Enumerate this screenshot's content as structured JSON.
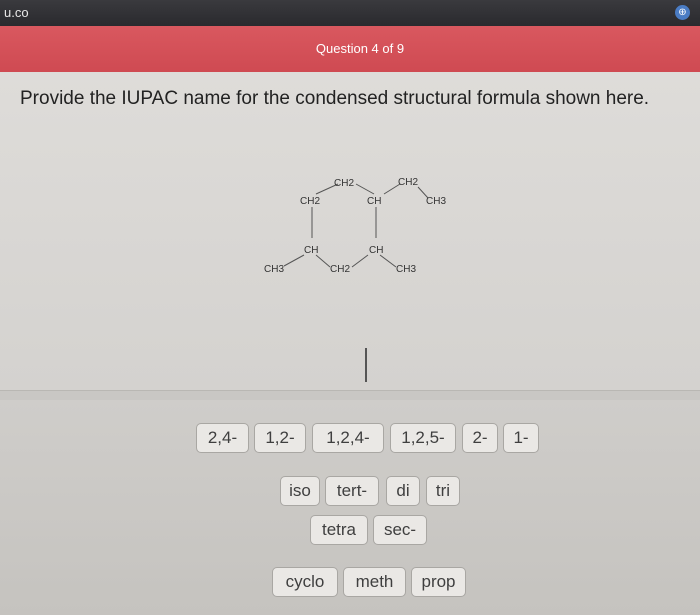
{
  "browser": {
    "url_fragment": "u.co"
  },
  "header": {
    "question_counter": "Question 4 of 9"
  },
  "question": {
    "prompt": "Provide the IUPAC name for the condensed structural formula shown here.",
    "formula_labels": {
      "top_ch2_left": "CH2",
      "top_ch2_right": "CH2",
      "ring_ch2_left": "CH2",
      "ring_ch": "CH",
      "right_ch3": "CH3",
      "ring_ch_bottom_left": "CH",
      "ring_ch_bottom_right": "CH",
      "left_ch3": "CH3",
      "bottom_ch2": "CH2",
      "bottom_ch3": "CH3"
    }
  },
  "tiles": {
    "t_2_4": "2,4-",
    "t_1_2": "1,2-",
    "t_1_2_4": "1,2,4-",
    "t_1_2_5": "1,2,5-",
    "t_2": "2-",
    "t_1": "1-",
    "iso": "iso",
    "tert": "tert-",
    "di": "di",
    "tri": "tri",
    "tetra": "tetra",
    "sec": "sec-",
    "cyclo": "cyclo",
    "meth": "meth",
    "prop": "prop"
  }
}
